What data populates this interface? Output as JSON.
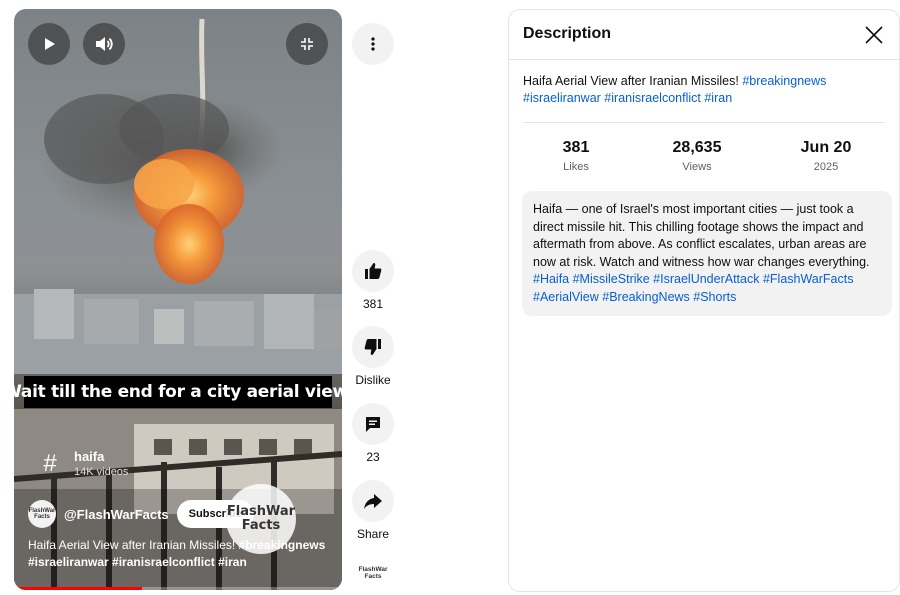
{
  "player": {
    "caption": "Wait till the end for a city aerial view.",
    "hashtag": {
      "symbol": "#",
      "name": "haifa",
      "count": "14K videos"
    },
    "channel": {
      "avatar_text": "FlashWar Facts",
      "name": "@FlashWarFacts",
      "subscribe_label": "Subscribe"
    },
    "watermark": "FlashWar Facts",
    "title_plain": "Haifa Aerial View after Iranian Missiles! ",
    "title_tags_1": "#breakingnews",
    "title_tags_2": "#israeliranwar #iranisraelconflict #iran",
    "progress": 0.39
  },
  "rail": {
    "likes": "381",
    "dislike_label": "Dislike",
    "comments": "23",
    "share_label": "Share",
    "avatar_text": "FlashWar Facts"
  },
  "panel": {
    "title": "Description",
    "headline_plain": "Haifa Aerial View after Iranian Missiles! ",
    "headline_tag_1": "#breakingnews",
    "headline_tag_2": "#israeliranwar",
    "headline_tag_3": "#iranisraelconflict",
    "headline_tag_4": "#iran",
    "stats": [
      {
        "value": "381",
        "label": "Likes"
      },
      {
        "value": "28,635",
        "label": "Views"
      },
      {
        "value": "Jun 20",
        "label": "2025"
      }
    ],
    "body": "Haifa — one of Israel's most important cities — just took a direct missile hit. This chilling footage shows the impact and aftermath from above. As conflict escalates, urban areas are now at risk. Watch and witness how war changes everything.",
    "body_tags": "#Haifa #MissileStrike #IsraelUnderAttack #FlashWarFacts #AerialView #BreakingNews #Shorts"
  },
  "colors": {
    "link": "#065fd4",
    "progress": "#ff0000",
    "surface": "#f2f2f2"
  }
}
